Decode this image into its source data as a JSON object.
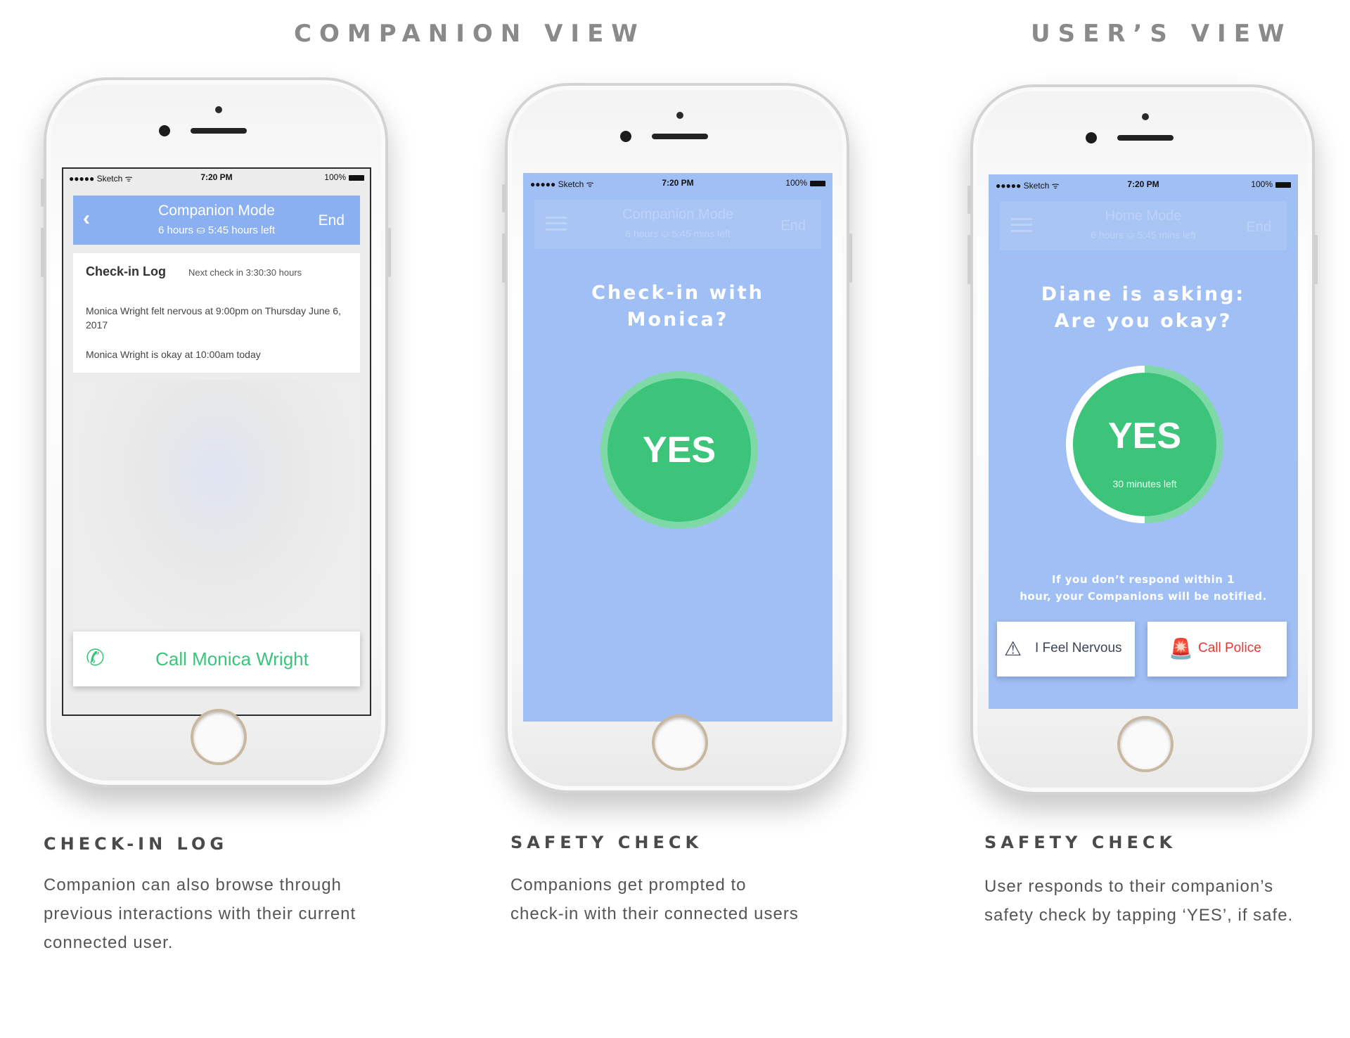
{
  "headings": {
    "companion_view": "COMPANION VIEW",
    "users_view": "USER’S VIEW"
  },
  "status_bar": {
    "carrier": "●●●●● Sketch ᯤ",
    "time": "7:20 PM",
    "battery": "100%"
  },
  "screen1": {
    "back_icon": "‹",
    "title": "Companion Mode",
    "subtitle": "6 hours  ⛀  5:45 hours left",
    "end_label": "End",
    "log_title": "Check-in Log",
    "next_check": "Next check in 3:30:30 hours",
    "entries": [
      "Monica Wright felt nervous at 9:00pm on Thursday June 6, 2017",
      "Monica Wright is okay at 10:00am today"
    ],
    "call_icon": "phone-icon",
    "call_label": "Call Monica Wright"
  },
  "screen2": {
    "header_title": "Companion Mode",
    "header_subtitle": "6 hours  ⛀  5:45 mins left",
    "end_label": "End",
    "question_line1": "Check-in with",
    "question_line2": "Monica?",
    "yes_label": "YES"
  },
  "screen3": {
    "header_title": "Home Mode",
    "header_subtitle": "6 hours  ⛀  5:45 mins left",
    "end_label": "End",
    "question_line1": "Diane is asking:",
    "question_line2": "Are you okay?",
    "yes_label": "YES",
    "minutes_left": "30 minutes left",
    "timer_fraction_remaining": 0.5,
    "notice_line1": "If you don’t respond within 1",
    "notice_line2": "hour, your Companions will be notified.",
    "nervous_label": "I Feel Nervous",
    "police_label": "Call Police"
  },
  "captions": [
    {
      "title": "CHECK-IN LOG",
      "lines": [
        "Companion can also browse through",
        "previous interactions with their current",
        "connected user."
      ]
    },
    {
      "title": "SAFETY CHECK",
      "lines": [
        "Companions get prompted to",
        "check-in with their connected users"
      ]
    },
    {
      "title": "SAFETY CHECK",
      "lines": [
        "User responds to their companion’s",
        "safety check by tapping ‘YES’, if safe."
      ]
    }
  ],
  "colors": {
    "screen_blue": "#a0bff5",
    "header_blue": "#8bb0f2",
    "yes_green": "#3cc57a",
    "call_green": "#3bc47b",
    "police_red": "#e53935"
  }
}
